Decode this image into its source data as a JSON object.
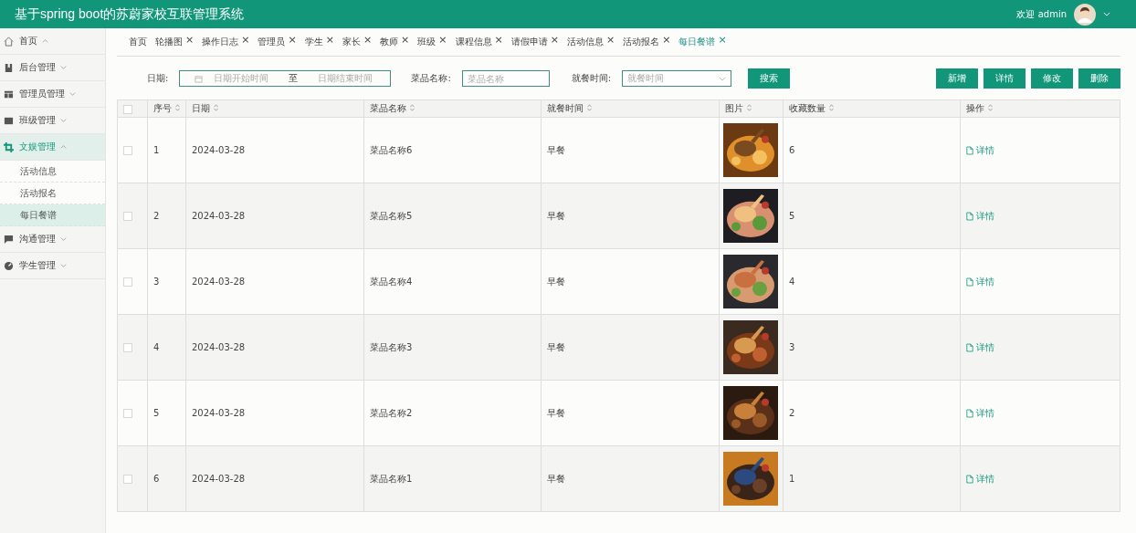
{
  "header": {
    "title": "基于spring boot的苏蔚家校互联管理系统",
    "welcome": "欢迎 admin"
  },
  "sidebar": {
    "items": [
      {
        "label": "首页",
        "expanded": true,
        "selected": false
      },
      {
        "label": "后台管理",
        "expanded": false,
        "selected": false
      },
      {
        "label": "管理员管理",
        "expanded": false,
        "selected": false
      },
      {
        "label": "班级管理",
        "expanded": false,
        "selected": false
      },
      {
        "label": "文娱管理",
        "expanded": true,
        "selected": true,
        "children": [
          {
            "label": "活动信息",
            "selected": false
          },
          {
            "label": "活动报名",
            "selected": false
          },
          {
            "label": "每日餐谱",
            "selected": true
          }
        ]
      },
      {
        "label": "沟通管理",
        "expanded": false,
        "selected": false
      },
      {
        "label": "学生管理",
        "expanded": false,
        "selected": false
      }
    ]
  },
  "tabs": [
    {
      "label": "首页",
      "closable": false,
      "selected": false
    },
    {
      "label": "轮播图",
      "closable": true,
      "selected": false
    },
    {
      "label": "操作日志",
      "closable": true,
      "selected": false
    },
    {
      "label": "管理员",
      "closable": true,
      "selected": false
    },
    {
      "label": "学生",
      "closable": true,
      "selected": false
    },
    {
      "label": "家长",
      "closable": true,
      "selected": false
    },
    {
      "label": "教师",
      "closable": true,
      "selected": false
    },
    {
      "label": "班级",
      "closable": true,
      "selected": false
    },
    {
      "label": "课程信息",
      "closable": true,
      "selected": false
    },
    {
      "label": "请假申请",
      "closable": true,
      "selected": false
    },
    {
      "label": "活动信息",
      "closable": true,
      "selected": false
    },
    {
      "label": "活动报名",
      "closable": true,
      "selected": false
    },
    {
      "label": "每日餐谱",
      "closable": true,
      "selected": true
    }
  ],
  "close_mark": "×",
  "filters": {
    "date_label": "日期:",
    "date_start_placeholder": "日期开始时间",
    "date_sep": "至",
    "date_end_placeholder": "日期结束时间",
    "name_label": "菜品名称:",
    "name_placeholder": "菜品名称",
    "meal_label": "就餐时间:",
    "meal_placeholder": "就餐时间",
    "search_button": "搜索"
  },
  "actions": [
    "新增",
    "详情",
    "修改",
    "删除"
  ],
  "table": {
    "all_checked": false,
    "columns": [
      {
        "label": "序号"
      },
      {
        "label": "日期"
      },
      {
        "label": "菜品名称"
      },
      {
        "label": "就餐时间"
      },
      {
        "label": "图片"
      },
      {
        "label": "收藏数量"
      },
      {
        "label": "操作"
      }
    ],
    "rows": [
      {
        "checked": false,
        "index": "1",
        "date": "2024-03-28",
        "name": "菜品名称6",
        "meal": "早餐",
        "count": "6",
        "action": "详情"
      },
      {
        "checked": false,
        "index": "2",
        "date": "2024-03-28",
        "name": "菜品名称5",
        "meal": "早餐",
        "count": "5",
        "action": "详情"
      },
      {
        "checked": false,
        "index": "3",
        "date": "2024-03-28",
        "name": "菜品名称4",
        "meal": "早餐",
        "count": "4",
        "action": "详情"
      },
      {
        "checked": false,
        "index": "4",
        "date": "2024-03-28",
        "name": "菜品名称3",
        "meal": "早餐",
        "count": "3",
        "action": "详情"
      },
      {
        "checked": false,
        "index": "5",
        "date": "2024-03-28",
        "name": "菜品名称2",
        "meal": "早餐",
        "count": "2",
        "action": "详情"
      },
      {
        "checked": false,
        "index": "6",
        "date": "2024-03-28",
        "name": "菜品名称1",
        "meal": "早餐",
        "count": "1",
        "action": "详情"
      }
    ]
  }
}
